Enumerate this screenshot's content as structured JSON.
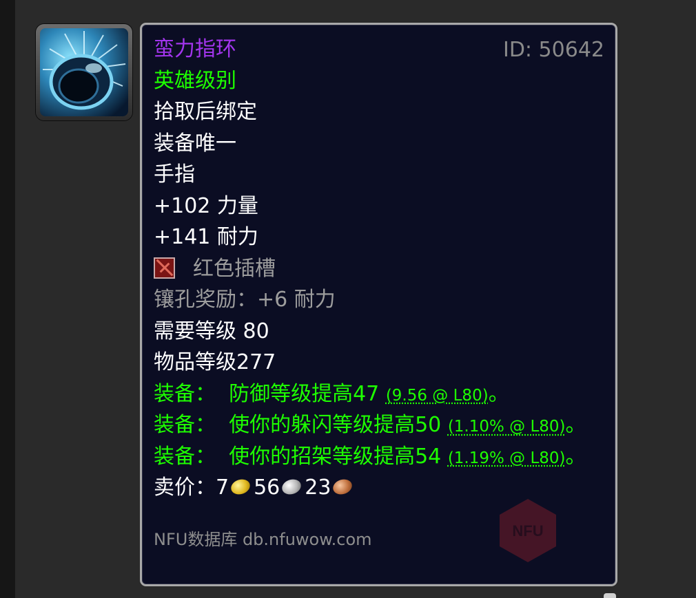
{
  "item": {
    "name": "蛮力指环",
    "id_text": "ID: 50642",
    "quality": "英雄级别",
    "binding": "拾取后绑定",
    "unique": "装备唯一",
    "slot": "手指",
    "stats": [
      "+102 力量",
      "+141 耐力"
    ],
    "socket": {
      "label": "红色插槽",
      "icon": "red-socket-icon"
    },
    "socket_bonus": "镶孔奖励：+6 耐力",
    "required_level": "需要等级 80",
    "item_level": "物品等级277",
    "equip_effects": [
      {
        "prefix": "装备：",
        "text": "防御等级提高47",
        "note": "(9.56 @ L80)",
        "suffix": "。"
      },
      {
        "prefix": "装备：",
        "text": "使你的躲闪等级提高50",
        "note": "(1.10% @ L80)",
        "suffix": "。"
      },
      {
        "prefix": "装备：",
        "text": "使你的招架等级提高54",
        "note": "(1.19% @ L80)",
        "suffix": "。"
      }
    ],
    "sell_price": {
      "label": "卖价：",
      "gold": "7",
      "silver": "56",
      "copper": "23"
    }
  },
  "footer": {
    "source": "NFU数据库 db.nfuwow.com"
  },
  "watermark": {
    "text": "NFU"
  },
  "colors": {
    "epic": "#a335ee",
    "uncommon": "#1eff00",
    "poor": "#9d9d9d",
    "panel_bg": "#0b0d23",
    "panel_border": "#a9a9a9"
  }
}
